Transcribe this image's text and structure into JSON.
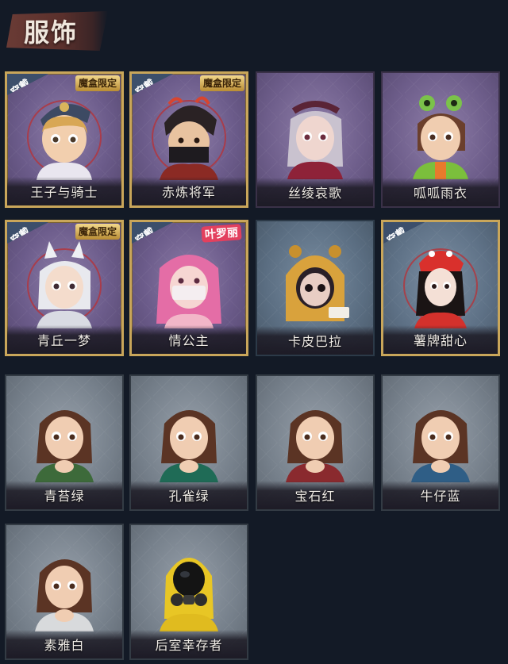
{
  "section": {
    "title": "服饰"
  },
  "badges": {
    "equip": "穿戴",
    "limited": "魔盒限定",
    "collab": "叶罗丽"
  },
  "costumes": [
    {
      "name": "王子与骑士",
      "equipped": true,
      "limited": true,
      "frame": "epic",
      "icon": "prince-knight-portrait-icon"
    },
    {
      "name": "赤炼将军",
      "equipped": true,
      "limited": true,
      "frame": "epic",
      "icon": "red-general-portrait-icon"
    },
    {
      "name": "丝绫哀歌",
      "equipped": false,
      "limited": false,
      "frame": "rare",
      "icon": "silk-elegy-portrait-icon"
    },
    {
      "name": "呱呱雨衣",
      "equipped": false,
      "limited": false,
      "frame": "rare",
      "icon": "frog-raincoat-portrait-icon"
    },
    {
      "name": "青丘一梦",
      "equipped": true,
      "limited": true,
      "frame": "epic",
      "icon": "fox-dream-portrait-icon"
    },
    {
      "name": "情公主",
      "equipped": true,
      "limited": false,
      "collab": true,
      "frame": "epic",
      "icon": "princess-portrait-icon"
    },
    {
      "name": "卡皮巴拉",
      "equipped": false,
      "limited": false,
      "frame": "blue",
      "icon": "capybara-portrait-icon"
    },
    {
      "name": "薯牌甜心",
      "equipped": true,
      "limited": false,
      "frame": "epic-gold",
      "icon": "fries-sweetheart-portrait-icon"
    },
    {
      "name": "青苔绿",
      "equipped": false,
      "limited": false,
      "frame": "gray",
      "icon": "moss-green-portrait-icon"
    },
    {
      "name": "孔雀绿",
      "equipped": false,
      "limited": false,
      "frame": "gray",
      "icon": "peacock-green-portrait-icon"
    },
    {
      "name": "宝石红",
      "equipped": false,
      "limited": false,
      "frame": "gray",
      "icon": "ruby-red-portrait-icon"
    },
    {
      "name": "牛仔蓝",
      "equipped": false,
      "limited": false,
      "frame": "gray",
      "icon": "denim-blue-portrait-icon"
    },
    {
      "name": "素雅白",
      "equipped": false,
      "limited": false,
      "frame": "gray",
      "icon": "elegant-white-portrait-icon"
    },
    {
      "name": "后室幸存者",
      "equipped": false,
      "limited": false,
      "frame": "gray",
      "icon": "backrooms-survivor-portrait-icon"
    }
  ],
  "colors": {
    "background": "#131a26",
    "gold_frame": "#c9a65a",
    "equip_badge": "#3c4f6b"
  }
}
